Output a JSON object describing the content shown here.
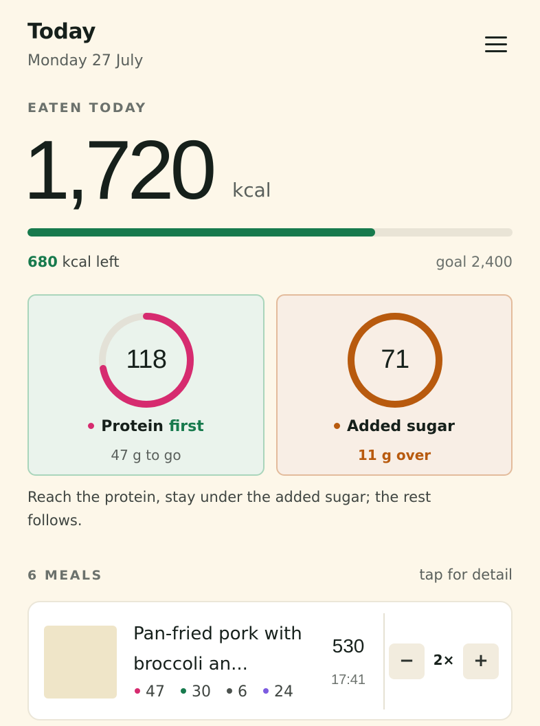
{
  "header": {
    "title": "Today",
    "date": "Monday 27 July",
    "menu_icon": "hamburger-menu-icon"
  },
  "eaten": {
    "label": "EATEN TODAY",
    "value": "1,720",
    "unit": "kcal",
    "progress_fraction": 0.717,
    "left_value": "680",
    "left_text": "kcal left",
    "goal_text": "goal 2,400"
  },
  "targets": {
    "protein": {
      "value": "118",
      "title": "Protein",
      "tag": "first",
      "sub": "47 g to go",
      "ring_fraction": 0.72,
      "color": "#d62b6f"
    },
    "sugar": {
      "value": "71",
      "title": "Added sugar",
      "sub": "11 g over",
      "ring_fraction": 1.0,
      "color": "#b85a0e"
    }
  },
  "note": "Reach the protein, stay under the added sugar; the rest follows.",
  "meals": {
    "label": "6 MEALS",
    "hint": "tap for detail",
    "items": [
      {
        "name": "Pan-fried pork with broccoli an...",
        "kcal": "530",
        "time": "17:41",
        "quantity": "2×",
        "macros": [
          {
            "value": "47",
            "color": "#d62b6f"
          },
          {
            "value": "30",
            "color": "#177a4d"
          },
          {
            "value": "6",
            "color": "#4c524e"
          },
          {
            "value": "24",
            "color": "#7c5be0"
          }
        ],
        "minus_label": "−",
        "plus_label": "+"
      }
    ]
  }
}
